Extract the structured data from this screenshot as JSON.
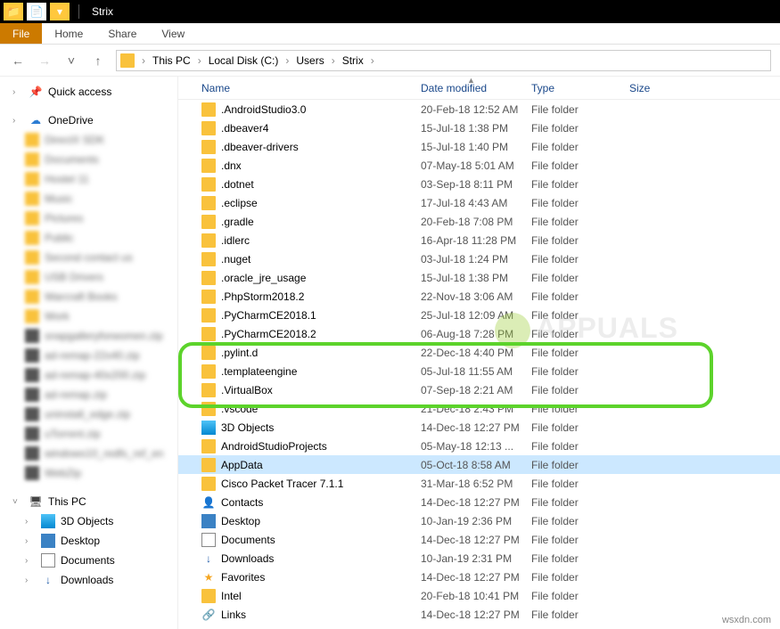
{
  "titlebar": {
    "title": "Strix"
  },
  "ribbon": {
    "file": "File",
    "home": "Home",
    "share": "Share",
    "view": "View"
  },
  "breadcrumb": [
    "This PC",
    "Local Disk (C:)",
    "Users",
    "Strix"
  ],
  "sidebar": {
    "quick": "Quick access",
    "onedrive": "OneDrive",
    "thispc": "This PC",
    "obj3d": "3D Objects",
    "desktop": "Desktop",
    "documents": "Documents",
    "downloads": "Downloads"
  },
  "columns": {
    "name": "Name",
    "date": "Date modified",
    "type": "Type",
    "size": "Size"
  },
  "files": [
    {
      "name": ".AndroidStudio3.0",
      "date": "20-Feb-18 12:52 AM",
      "type": "File folder",
      "icon": "folder"
    },
    {
      "name": ".dbeaver4",
      "date": "15-Jul-18 1:38 PM",
      "type": "File folder",
      "icon": "folder"
    },
    {
      "name": ".dbeaver-drivers",
      "date": "15-Jul-18 1:40 PM",
      "type": "File folder",
      "icon": "folder"
    },
    {
      "name": ".dnx",
      "date": "07-May-18 5:01 AM",
      "type": "File folder",
      "icon": "folder"
    },
    {
      "name": ".dotnet",
      "date": "03-Sep-18 8:11 PM",
      "type": "File folder",
      "icon": "folder"
    },
    {
      "name": ".eclipse",
      "date": "17-Jul-18 4:43 AM",
      "type": "File folder",
      "icon": "folder"
    },
    {
      "name": ".gradle",
      "date": "20-Feb-18 7:08 PM",
      "type": "File folder",
      "icon": "folder"
    },
    {
      "name": ".idlerc",
      "date": "16-Apr-18 11:28 PM",
      "type": "File folder",
      "icon": "folder"
    },
    {
      "name": ".nuget",
      "date": "03-Jul-18 1:24 PM",
      "type": "File folder",
      "icon": "folder"
    },
    {
      "name": ".oracle_jre_usage",
      "date": "15-Jul-18 1:38 PM",
      "type": "File folder",
      "icon": "folder"
    },
    {
      "name": ".PhpStorm2018.2",
      "date": "22-Nov-18 3:06 AM",
      "type": "File folder",
      "icon": "folder"
    },
    {
      "name": ".PyCharmCE2018.1",
      "date": "25-Jul-18 12:09 AM",
      "type": "File folder",
      "icon": "folder"
    },
    {
      "name": ".PyCharmCE2018.2",
      "date": "06-Aug-18 7:28 PM",
      "type": "File folder",
      "icon": "folder"
    },
    {
      "name": ".pylint.d",
      "date": "22-Dec-18 4:40 PM",
      "type": "File folder",
      "icon": "folder"
    },
    {
      "name": ".templateengine",
      "date": "05-Jul-18 11:55 AM",
      "type": "File folder",
      "icon": "folder"
    },
    {
      "name": ".VirtualBox",
      "date": "07-Sep-18 2:21 AM",
      "type": "File folder",
      "icon": "folder"
    },
    {
      "name": ".vscode",
      "date": "21-Dec-18 2:43 PM",
      "type": "File folder",
      "icon": "folder"
    },
    {
      "name": "3D Objects",
      "date": "14-Dec-18 12:27 PM",
      "type": "File folder",
      "icon": "obj3d"
    },
    {
      "name": "AndroidStudioProjects",
      "date": "05-May-18 12:13 ...",
      "type": "File folder",
      "icon": "folder",
      "group": true
    },
    {
      "name": "AppData",
      "date": "05-Oct-18 8:58 AM",
      "type": "File folder",
      "icon": "folder",
      "selected": true,
      "group": true
    },
    {
      "name": "Cisco Packet Tracer 7.1.1",
      "date": "31-Mar-18 6:52 PM",
      "type": "File folder",
      "icon": "folder",
      "group": true
    },
    {
      "name": "Contacts",
      "date": "14-Dec-18 12:27 PM",
      "type": "File folder",
      "icon": "contacts"
    },
    {
      "name": "Desktop",
      "date": "10-Jan-19 2:36 PM",
      "type": "File folder",
      "icon": "desktop"
    },
    {
      "name": "Documents",
      "date": "14-Dec-18 12:27 PM",
      "type": "File folder",
      "icon": "docs"
    },
    {
      "name": "Downloads",
      "date": "10-Jan-19 2:31 PM",
      "type": "File folder",
      "icon": "down"
    },
    {
      "name": "Favorites",
      "date": "14-Dec-18 12:27 PM",
      "type": "File folder",
      "icon": "fav"
    },
    {
      "name": "Intel",
      "date": "20-Feb-18 10:41 PM",
      "type": "File folder",
      "icon": "folder"
    },
    {
      "name": "Links",
      "date": "14-Dec-18 12:27 PM",
      "type": "File folder",
      "icon": "links"
    }
  ],
  "watermark": "APPUALS",
  "footer": "wsxdn.com"
}
